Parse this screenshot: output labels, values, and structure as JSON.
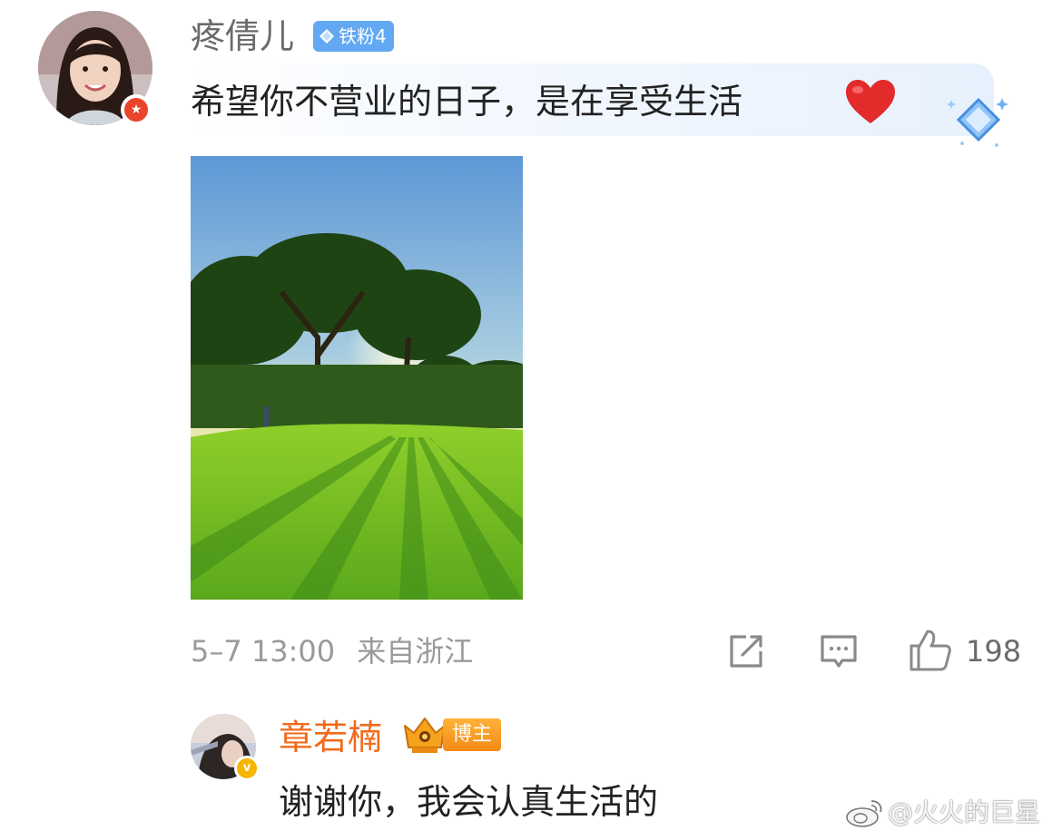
{
  "comment": {
    "username": "疼倩儿",
    "fan_badge": "铁粉4",
    "text": "希望你不营业的日子，是在享受生活",
    "emoji_icon": "heart-icon",
    "time": "5–7 13:00",
    "location": "来自浙江",
    "like_count": "198",
    "colors": {
      "fan_badge": "#62a8f2",
      "avatar_badge": "#e8452c"
    }
  },
  "reply": {
    "username": "章若楠",
    "badge": "博主",
    "text": "谢谢你，我会认真生活的",
    "colors": {
      "username": "#f26a1b",
      "badge": "#f48a16"
    }
  },
  "watermark": "@火火的巨星"
}
